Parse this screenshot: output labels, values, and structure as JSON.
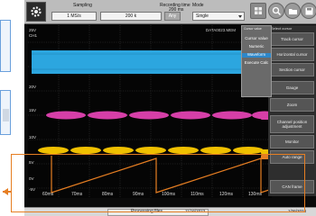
{
  "topbar": {
    "sampling_label": "Sampling",
    "sampling_value": "1 MS/s",
    "points_value": "200 k",
    "any_label": "Any",
    "recording_label": "Recording time",
    "recording_value": "200 ms",
    "mode_label": "Mode",
    "mode_value": "Single"
  },
  "waveform": {
    "file_name": "DATA0023.MEM",
    "y_labels": [
      "25V",
      "CH1",
      "20V",
      "15V",
      "10V",
      "5V",
      "0V",
      "-5V"
    ],
    "x_labels": [
      "60ms",
      "70ms",
      "80ms",
      "90ms",
      "100ms",
      "110ms",
      "120ms",
      "130ms",
      "140ms"
    ]
  },
  "right_panel": {
    "header": "Select cursor",
    "buttons": [
      "Track cursor",
      "Horizontal cursor",
      "Section cursor",
      "Gauge",
      "Zoom",
      "Channel position adjustment",
      "Monitor",
      "Auto range",
      "CAN frame"
    ]
  },
  "cursor_overlay": {
    "header": "Cursor value",
    "items": [
      "Cursor value",
      "Numeric",
      "Waveform",
      "Execute Calc"
    ]
  },
  "bottombar": {
    "status": "Processing files",
    "date_left": "11/16/2023",
    "date_right": "1/26/2024"
  },
  "colors": {
    "cyan": "#2ca6df",
    "magenta": "#d63fa8",
    "yellow": "#f0c000",
    "orange": "#e67e22"
  }
}
